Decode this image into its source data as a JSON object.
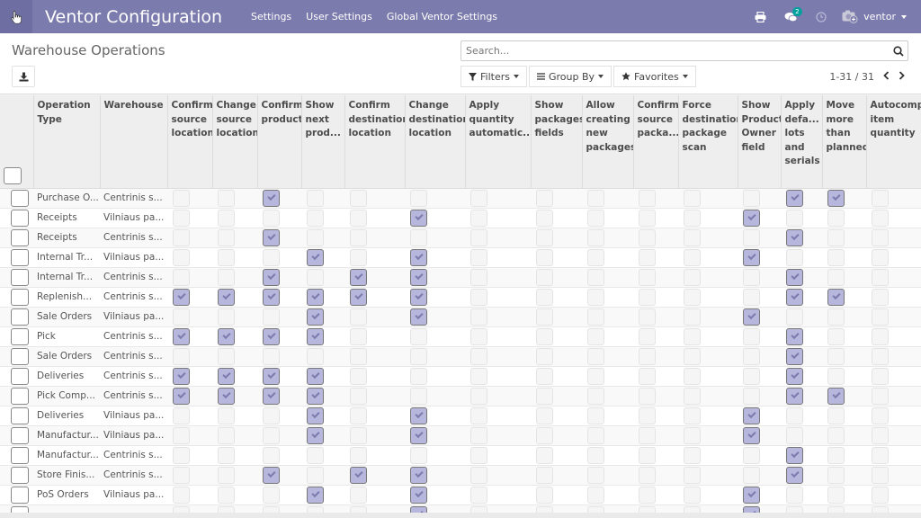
{
  "topbar": {
    "app_title": "Ventor Configuration",
    "menu": [
      "Settings",
      "User Settings",
      "Global Ventor Settings"
    ],
    "messages_badge": "2",
    "user_name": "ventor",
    "accent_color": "#7c7bad"
  },
  "control_panel": {
    "page_title": "Warehouse Operations",
    "search_placeholder": "Search...",
    "filters_label": "Filters",
    "groupby_label": "Group By",
    "favorites_label": "Favorites",
    "pager": "1-31 / 31"
  },
  "table": {
    "columns": [
      "Operation Type",
      "Warehouse",
      "Confirm source location",
      "Change source location",
      "Confirm product",
      "Show next prod...",
      "Confirm destination location",
      "Change destination location",
      "Apply quantity automatic...",
      "Show packages fields",
      "Allow creating new packages",
      "Confirm source packa...",
      "Force destination package scan",
      "Show Product Owner field",
      "Apply defa... lots and serials",
      "Move more than planned",
      "Autocomp... item quantity"
    ],
    "rows": [
      {
        "op": "Purchase O...",
        "wh": "Centrinis s...",
        "flags": [
          0,
          0,
          1,
          0,
          0,
          0,
          0,
          0,
          0,
          0,
          0,
          0,
          1,
          1,
          0
        ]
      },
      {
        "op": "Receipts",
        "wh": "Vilniaus pa...",
        "flags": [
          0,
          0,
          0,
          0,
          0,
          1,
          0,
          0,
          0,
          0,
          0,
          1,
          0,
          0,
          0
        ]
      },
      {
        "op": "Receipts",
        "wh": "Centrinis s...",
        "flags": [
          0,
          0,
          1,
          0,
          0,
          0,
          0,
          0,
          0,
          0,
          0,
          0,
          1,
          0,
          0
        ]
      },
      {
        "op": "Internal Tr...",
        "wh": "Vilniaus pa...",
        "flags": [
          0,
          0,
          0,
          1,
          0,
          1,
          0,
          0,
          0,
          0,
          0,
          1,
          0,
          0,
          0
        ]
      },
      {
        "op": "Internal Tr...",
        "wh": "Centrinis s...",
        "flags": [
          0,
          0,
          1,
          0,
          1,
          1,
          0,
          0,
          0,
          0,
          0,
          0,
          1,
          0,
          0
        ]
      },
      {
        "op": "Replenish...",
        "wh": "Centrinis s...",
        "flags": [
          1,
          1,
          1,
          1,
          1,
          1,
          0,
          0,
          0,
          0,
          0,
          0,
          1,
          1,
          0
        ]
      },
      {
        "op": "Sale Orders",
        "wh": "Vilniaus pa...",
        "flags": [
          0,
          0,
          0,
          1,
          0,
          1,
          0,
          0,
          0,
          0,
          0,
          1,
          0,
          0,
          0
        ]
      },
      {
        "op": "Pick",
        "wh": "Centrinis s...",
        "flags": [
          1,
          1,
          1,
          1,
          0,
          0,
          0,
          0,
          0,
          0,
          0,
          0,
          1,
          0,
          0
        ]
      },
      {
        "op": "Sale Orders",
        "wh": "Centrinis s...",
        "flags": [
          0,
          0,
          0,
          0,
          0,
          0,
          0,
          0,
          0,
          0,
          0,
          0,
          1,
          0,
          0
        ]
      },
      {
        "op": "Deliveries",
        "wh": "Centrinis s...",
        "flags": [
          1,
          1,
          1,
          1,
          0,
          0,
          0,
          0,
          0,
          0,
          0,
          0,
          1,
          0,
          0
        ]
      },
      {
        "op": "Pick Comp...",
        "wh": "Centrinis s...",
        "flags": [
          1,
          1,
          1,
          1,
          0,
          0,
          0,
          0,
          0,
          0,
          0,
          0,
          1,
          1,
          0
        ]
      },
      {
        "op": "Deliveries",
        "wh": "Vilniaus pa...",
        "flags": [
          0,
          0,
          0,
          1,
          0,
          1,
          0,
          0,
          0,
          0,
          0,
          1,
          0,
          0,
          0
        ]
      },
      {
        "op": "Manufactur...",
        "wh": "Vilniaus pa...",
        "flags": [
          0,
          0,
          0,
          1,
          0,
          1,
          0,
          0,
          0,
          0,
          0,
          1,
          0,
          0,
          0
        ]
      },
      {
        "op": "Manufactur...",
        "wh": "Centrinis s...",
        "flags": [
          0,
          0,
          0,
          0,
          0,
          0,
          0,
          0,
          0,
          0,
          0,
          0,
          1,
          0,
          0
        ]
      },
      {
        "op": "Store Finis...",
        "wh": "Centrinis s...",
        "flags": [
          0,
          0,
          1,
          0,
          1,
          1,
          0,
          0,
          0,
          0,
          0,
          0,
          1,
          0,
          0
        ]
      },
      {
        "op": "PoS Orders",
        "wh": "Vilniaus pa...",
        "flags": [
          0,
          0,
          0,
          1,
          0,
          1,
          0,
          0,
          0,
          0,
          0,
          1,
          0,
          0,
          0
        ]
      },
      {
        "op": "",
        "wh": "",
        "flags": [
          0,
          0,
          0,
          0,
          0,
          1,
          0,
          0,
          0,
          0,
          0,
          1,
          0,
          0,
          0
        ]
      }
    ]
  }
}
